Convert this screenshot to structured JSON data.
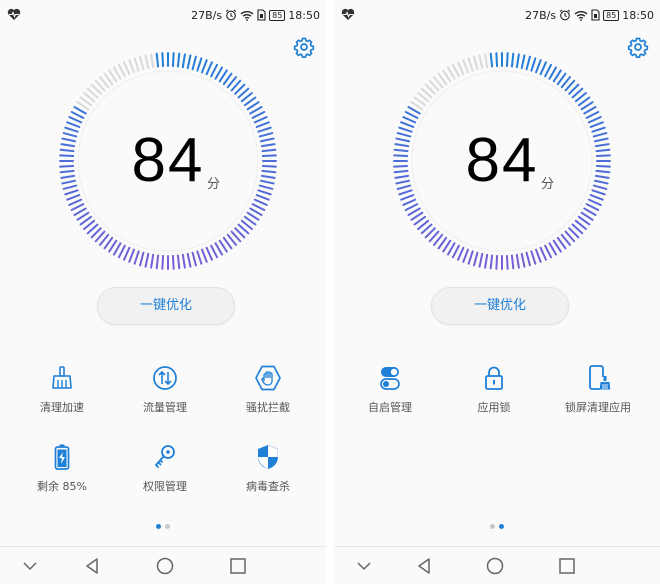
{
  "screens": [
    {
      "status": {
        "speed": "27B/s",
        "battery": "85",
        "time": "18:50"
      },
      "score": "84",
      "score_unit": "分",
      "optimize_label": "一键优化",
      "tiles": [
        {
          "label": "清理加速",
          "icon": "broom-icon"
        },
        {
          "label": "流量管理",
          "icon": "data-traffic-icon"
        },
        {
          "label": "骚扰拦截",
          "icon": "block-hand-icon"
        },
        {
          "label": "剩余 85%",
          "icon": "battery-icon"
        },
        {
          "label": "权限管理",
          "icon": "key-icon"
        },
        {
          "label": "病毒查杀",
          "icon": "shield-icon"
        }
      ],
      "page_indicator": {
        "count": 2,
        "active": 0
      }
    },
    {
      "status": {
        "speed": "27B/s",
        "battery": "85",
        "time": "18:50"
      },
      "score": "84",
      "score_unit": "分",
      "optimize_label": "一键优化",
      "tiles": [
        {
          "label": "自启管理",
          "icon": "toggle-icon"
        },
        {
          "label": "应用锁",
          "icon": "lock-icon"
        },
        {
          "label": "锁屏清理应用",
          "icon": "phone-clean-icon"
        }
      ],
      "page_indicator": {
        "count": 2,
        "active": 1
      }
    }
  ],
  "colors": {
    "accent": "#1f80d8",
    "ring_purple": "#7b5cd6",
    "ring_inactive": "#d9d9d9",
    "label": "#555555"
  }
}
